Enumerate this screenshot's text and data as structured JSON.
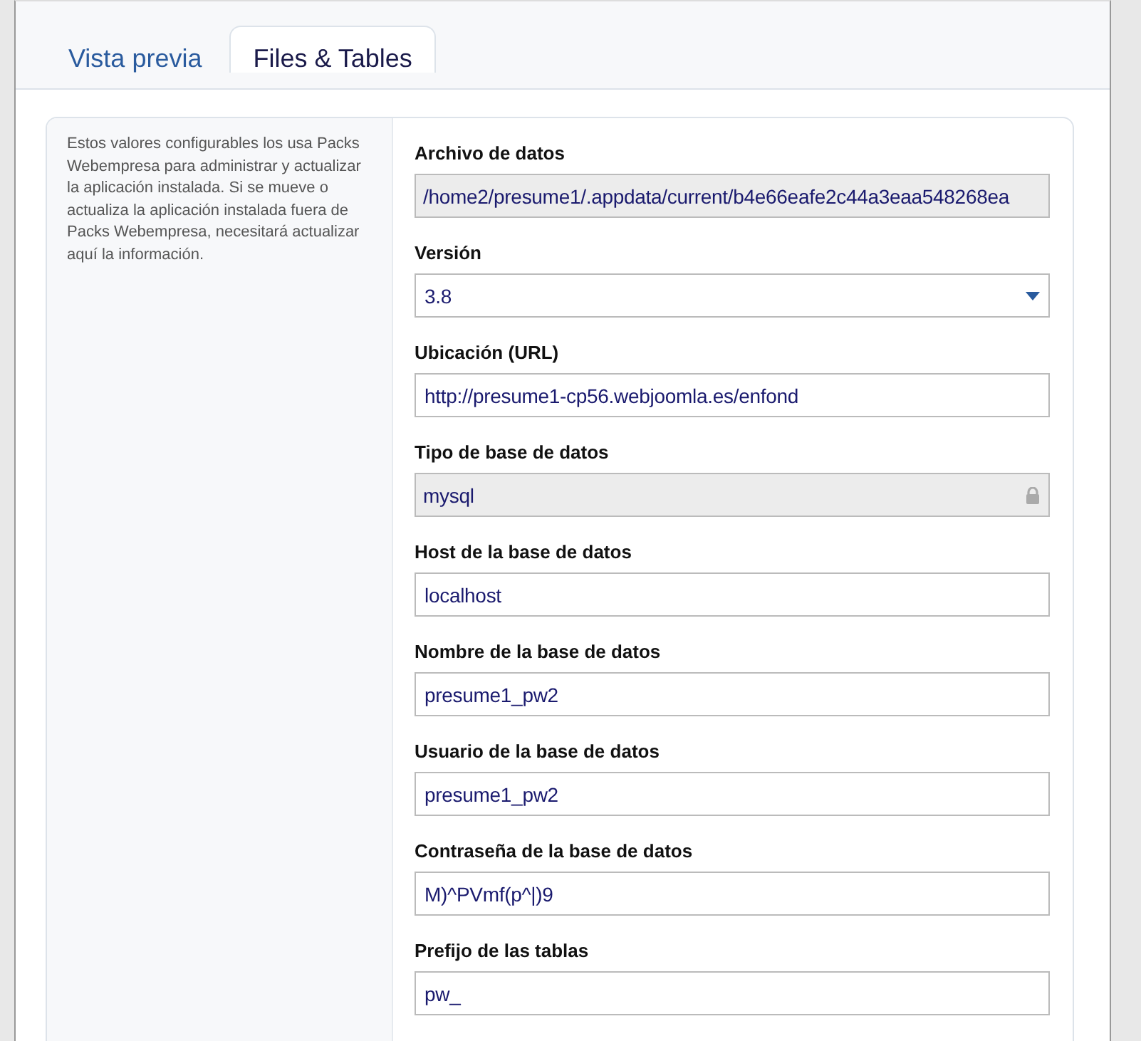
{
  "tabs": [
    {
      "label": "Vista previa",
      "selected": false
    },
    {
      "label": "Files & Tables",
      "selected": true
    }
  ],
  "help_text": "Estos valores configurables los usa Packs Webempresa para administrar y actualizar la aplicación instalada. Si se mueve o actualiza la aplicación instalada fuera de Packs Webempresa, necesitará actualizar aquí la información.",
  "fields": [
    {
      "label": "Archivo de datos",
      "kind": "readonly",
      "value": "/home2/presume1/.appdata/current/b4e66eafe2c44a3eaa548268ea"
    },
    {
      "label": "Versión",
      "kind": "select",
      "value": "3.8"
    },
    {
      "label": "Ubicación (URL)",
      "kind": "text",
      "value": "http://presume1-cp56.webjoomla.es/enfond"
    },
    {
      "label": "Tipo de base de datos",
      "kind": "locked",
      "value": "mysql"
    },
    {
      "label": "Host de la base de datos",
      "kind": "text",
      "value": "localhost"
    },
    {
      "label": "Nombre de la base de datos",
      "kind": "text",
      "value": "presume1_pw2"
    },
    {
      "label": "Usuario de la base de datos",
      "kind": "text",
      "value": "presume1_pw2"
    },
    {
      "label": "Contraseña de la base de datos",
      "kind": "text",
      "value": "M)^PVmf(p^|)9"
    },
    {
      "label": "Prefijo de las tablas",
      "kind": "text",
      "value": "pw_"
    }
  ]
}
